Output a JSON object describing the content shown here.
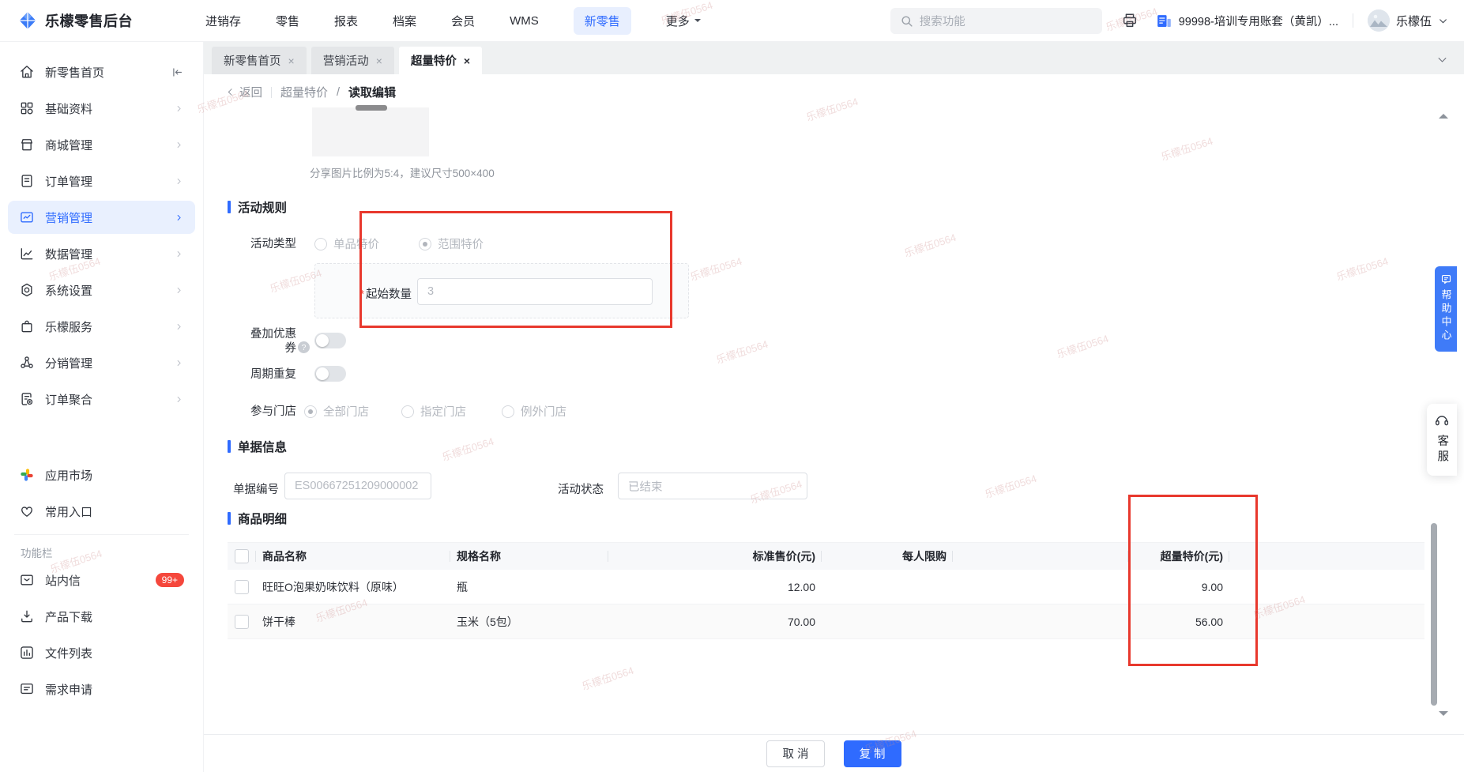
{
  "topbar": {
    "logo": "乐檬零售后台",
    "menu": [
      "进销存",
      "零售",
      "报表",
      "档案",
      "会员",
      "WMS",
      "新零售",
      "更多"
    ],
    "active": "新零售",
    "search_placeholder": "搜索功能",
    "account": "99998-培训专用账套（黄凯）...",
    "user": "乐檬伍"
  },
  "sidebar": {
    "items": [
      {
        "label": "新零售首页"
      },
      {
        "label": "基础资料"
      },
      {
        "label": "商城管理"
      },
      {
        "label": "订单管理"
      },
      {
        "label": "营销管理"
      },
      {
        "label": "数据管理"
      },
      {
        "label": "系统设置"
      },
      {
        "label": "乐檬服务"
      },
      {
        "label": "分销管理"
      },
      {
        "label": "订单聚合"
      }
    ],
    "active": "营销管理",
    "quick": [
      {
        "label": "应用市场"
      },
      {
        "label": "常用入口"
      }
    ],
    "section": "功能栏",
    "tools": [
      {
        "label": "站内信",
        "badge": "99+"
      },
      {
        "label": "产品下载"
      },
      {
        "label": "文件列表"
      },
      {
        "label": "需求申请"
      }
    ]
  },
  "tabs": [
    {
      "label": "新零售首页"
    },
    {
      "label": "营销活动"
    },
    {
      "label": "超量特价"
    }
  ],
  "active_tab": "超量特价",
  "breadcrumb": {
    "back": "返回",
    "parent": "超量特价",
    "sep": "/",
    "current": "读取编辑"
  },
  "upload": {
    "hint": "分享图片比例为5:4，建议尺寸500×400"
  },
  "rules": {
    "title": "活动规则",
    "type_label": "活动类型",
    "type_options": [
      "单品特价",
      "范围特价"
    ],
    "selected_type": "范围特价",
    "qty_label": "起始数量",
    "qty_value": "3",
    "coupon_label_line1": "叠加优惠",
    "coupon_label_line2": "券",
    "coupon_enabled": false,
    "repeat_label": "周期重复",
    "repeat_enabled": false,
    "stores_label": "参与门店",
    "store_options": [
      "全部门店",
      "指定门店",
      "例外门店"
    ],
    "selected_store": "全部门店"
  },
  "doc": {
    "title": "单据信息",
    "no_label": "单据编号",
    "no_value": "ES00667251209000002",
    "status_label": "活动状态",
    "status_value": "已结束"
  },
  "products": {
    "title": "商品明细",
    "columns": [
      "商品名称",
      "规格名称",
      "标准售价(元)",
      "每人限购",
      "超量特价(元)"
    ],
    "rows": [
      {
        "name": "旺旺O泡果奶味饮料（原味）",
        "spec": "瓶",
        "price": "12.00",
        "limit": "",
        "special": "9.00"
      },
      {
        "name": "饼干棒",
        "spec": "玉米（5包）",
        "price": "70.00",
        "limit": "",
        "special": "56.00"
      }
    ]
  },
  "footer": {
    "cancel": "取 消",
    "copy": "复 制"
  },
  "floating": {
    "help": "帮助中心",
    "service": "客服"
  },
  "icons": {
    "close": "×",
    "help": "?"
  },
  "watermark": {
    "text": "乐檬伍0564"
  },
  "colors": {
    "accent": "#2f6bff",
    "annotation": "#e8382d",
    "badge": "#f5473c"
  }
}
